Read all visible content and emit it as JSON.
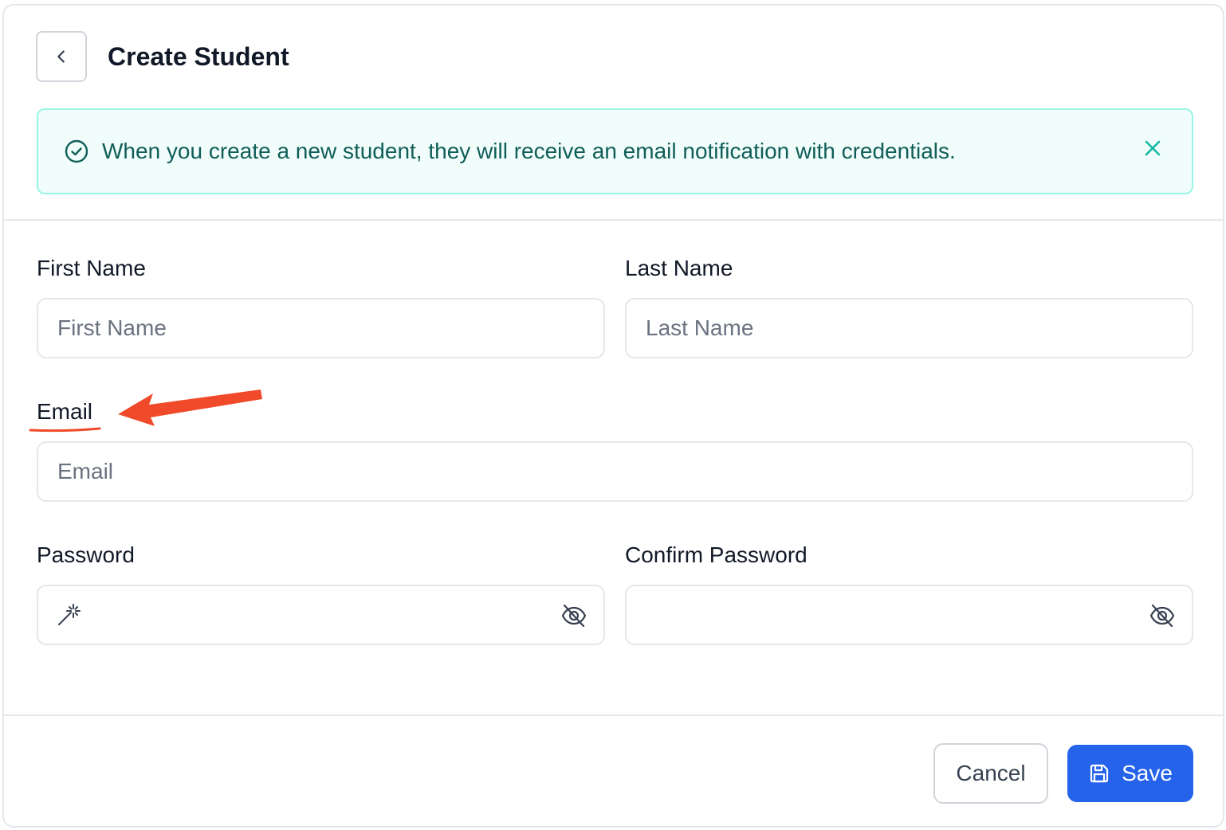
{
  "header": {
    "title": "Create Student",
    "back_icon": "chevron-left-icon"
  },
  "alert": {
    "message": "When you create a new student, they will receive an email notification with credentials.",
    "icon": "check-circle-icon",
    "close_icon": "close-icon",
    "color": "#115e59",
    "background": "#f0fdfa",
    "border": "#99f6e4"
  },
  "form": {
    "first_name": {
      "label": "First Name",
      "placeholder": "First Name",
      "value": ""
    },
    "last_name": {
      "label": "Last Name",
      "placeholder": "Last Name",
      "value": ""
    },
    "email": {
      "label": "Email",
      "placeholder": "Email",
      "value": ""
    },
    "password": {
      "label": "Password",
      "value": "",
      "left_icon": "magic-wand-icon",
      "right_icon": "eye-off-icon"
    },
    "confirm_password": {
      "label": "Confirm Password",
      "value": "",
      "right_icon": "eye-off-icon"
    }
  },
  "footer": {
    "cancel_label": "Cancel",
    "save_label": "Save",
    "save_icon": "save-icon",
    "primary_color": "#2563eb"
  },
  "annotation": {
    "color": "#f04a2a",
    "target": "Email"
  }
}
